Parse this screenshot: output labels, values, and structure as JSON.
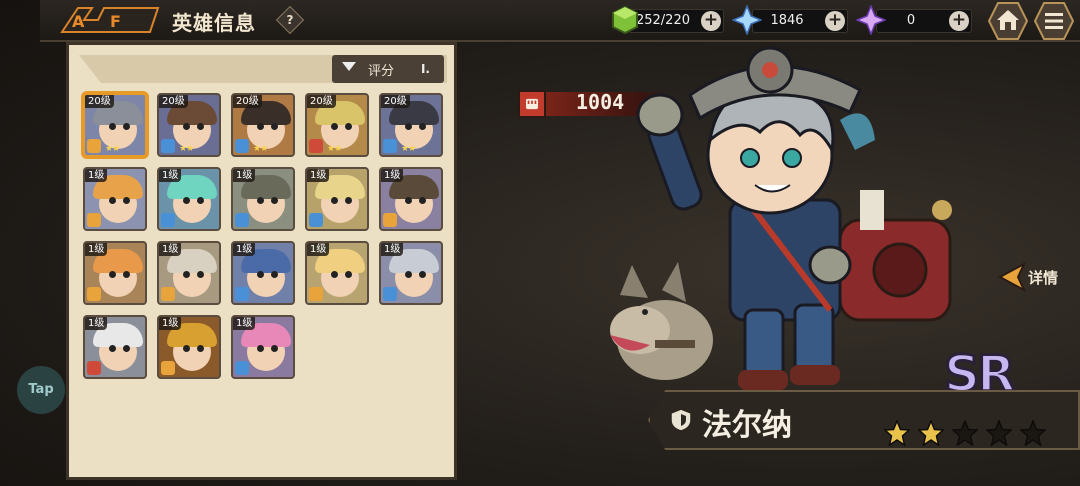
{
  "header": {
    "title": "英雄信息",
    "help_label": "?",
    "resources": [
      {
        "name": "stamina",
        "icon": "green-cube-icon",
        "value": "252/220"
      },
      {
        "name": "blue-crystal",
        "icon": "blue-crystal-icon",
        "value": "1846"
      },
      {
        "name": "purple-crystal",
        "icon": "purple-crystal-icon",
        "value": "0"
      }
    ],
    "plus_label": "+",
    "home_icon": "home-icon",
    "menu_icon": "menu-icon"
  },
  "tap_label": "Tap",
  "list": {
    "sort_label": "评分",
    "sort_icon": "filter-icon",
    "heroes": [
      {
        "level": "20级",
        "stars": "★★",
        "hair": "#8a8f99",
        "bg": "#7d86a8",
        "cls": "#e8a43a",
        "selected": true
      },
      {
        "level": "20级",
        "stars": "★★",
        "hair": "#6b4a36",
        "bg": "#6a6d94",
        "cls": "#4a90d6",
        "selected": false
      },
      {
        "level": "20级",
        "stars": "★★",
        "hair": "#3a2e28",
        "bg": "#b07a45",
        "cls": "#4a90d6",
        "selected": false
      },
      {
        "level": "20级",
        "stars": "★★",
        "hair": "#d9c46a",
        "bg": "#b48a4a",
        "cls": "#d04a3a",
        "selected": false
      },
      {
        "level": "20级",
        "stars": "★★",
        "hair": "#3a3a44",
        "bg": "#6d7396",
        "cls": "#4a90d6",
        "selected": false
      },
      {
        "level": "1级",
        "stars": "",
        "hair": "#e8a24a",
        "bg": "#8c93b0",
        "cls": "#e8a43a",
        "selected": false
      },
      {
        "level": "1级",
        "stars": "",
        "hair": "#6fd4c0",
        "bg": "#6a92a8",
        "cls": "#4a90d6",
        "selected": false
      },
      {
        "level": "1级",
        "stars": "",
        "hair": "#6a6a5a",
        "bg": "#8a8f80",
        "cls": "#4a90d6",
        "selected": false
      },
      {
        "level": "1级",
        "stars": "",
        "hair": "#e8d48a",
        "bg": "#b7a36a",
        "cls": "#4a90d6",
        "selected": false
      },
      {
        "level": "1级",
        "stars": "",
        "hair": "#5a4a3a",
        "bg": "#8a80a0",
        "cls": "#e8a43a",
        "selected": false
      },
      {
        "level": "1级",
        "stars": "",
        "hair": "#e89a4a",
        "bg": "#a88458",
        "cls": "#e8a43a",
        "selected": false
      },
      {
        "level": "1级",
        "stars": "",
        "hair": "#d8d0c0",
        "bg": "#a89a80",
        "cls": "#e8a43a",
        "selected": false
      },
      {
        "level": "1级",
        "stars": "",
        "hair": "#4a6aa8",
        "bg": "#7080a8",
        "cls": "#4a90d6",
        "selected": false
      },
      {
        "level": "1级",
        "stars": "",
        "hair": "#f0d080",
        "bg": "#b8a470",
        "cls": "#e8a43a",
        "selected": false
      },
      {
        "level": "1级",
        "stars": "",
        "hair": "#c8ccd4",
        "bg": "#8a8ea8",
        "cls": "#4a90d6",
        "selected": false
      },
      {
        "level": "1级",
        "stars": "",
        "hair": "#e8e8e8",
        "bg": "#8a8f99",
        "cls": "#d04a3a",
        "selected": false
      },
      {
        "level": "1级",
        "stars": "",
        "hair": "#d8a030",
        "bg": "#8a5a2a",
        "cls": "#e8a43a",
        "selected": false
      },
      {
        "level": "1级",
        "stars": "",
        "hair": "#e888b8",
        "bg": "#8a7aa0",
        "cls": "#4a90d6",
        "selected": false
      }
    ]
  },
  "hero": {
    "power": "1004",
    "power_icon": "fist-icon",
    "details_label": "详情",
    "rarity": "SR",
    "name": "法尔纳",
    "class_icon": "shield-icon",
    "stars_filled": 2,
    "stars_total": 5
  }
}
